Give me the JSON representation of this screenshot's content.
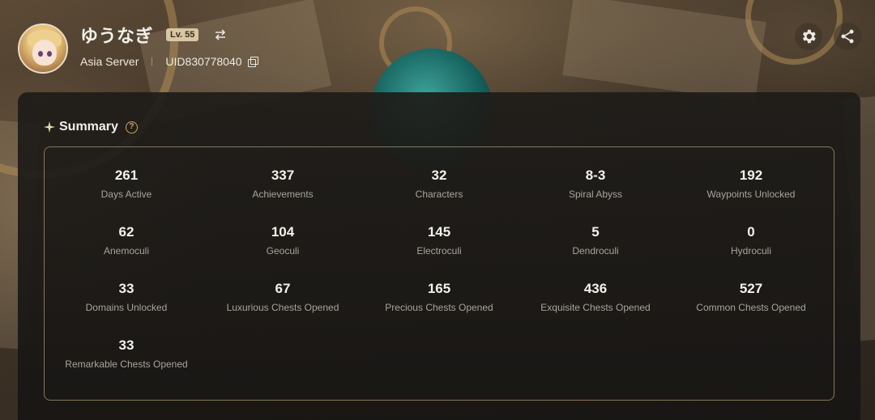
{
  "profile": {
    "username": "ゆうなぎ",
    "level": "Lv. 55",
    "server": "Asia Server",
    "uid": "UID830778040"
  },
  "icons": {
    "switch": "swap-arrows-icon",
    "copy": "copy-icon",
    "settings": "gear-icon",
    "share": "share-icon",
    "sparkle": "sparkle-icon",
    "help": "question-circle-icon"
  },
  "summary": {
    "title": "Summary",
    "stats": [
      {
        "value": "261",
        "label": "Days Active"
      },
      {
        "value": "337",
        "label": "Achievements"
      },
      {
        "value": "32",
        "label": "Characters"
      },
      {
        "value": "8-3",
        "label": "Spiral Abyss"
      },
      {
        "value": "192",
        "label": "Waypoints Unlocked"
      },
      {
        "value": "62",
        "label": "Anemoculi"
      },
      {
        "value": "104",
        "label": "Geoculi"
      },
      {
        "value": "145",
        "label": "Electroculi"
      },
      {
        "value": "5",
        "label": "Dendroculi"
      },
      {
        "value": "0",
        "label": "Hydroculi"
      },
      {
        "value": "33",
        "label": "Domains Unlocked"
      },
      {
        "value": "67",
        "label": "Luxurious Chests Opened"
      },
      {
        "value": "165",
        "label": "Precious Chests Opened"
      },
      {
        "value": "436",
        "label": "Exquisite Chests Opened"
      },
      {
        "value": "527",
        "label": "Common Chests Opened"
      },
      {
        "value": "33",
        "label": "Remarkable Chests Opened"
      }
    ]
  },
  "colors": {
    "accent": "#c9a86c",
    "level_badge": "#d9c6a2",
    "card_border": "#8c7650"
  }
}
